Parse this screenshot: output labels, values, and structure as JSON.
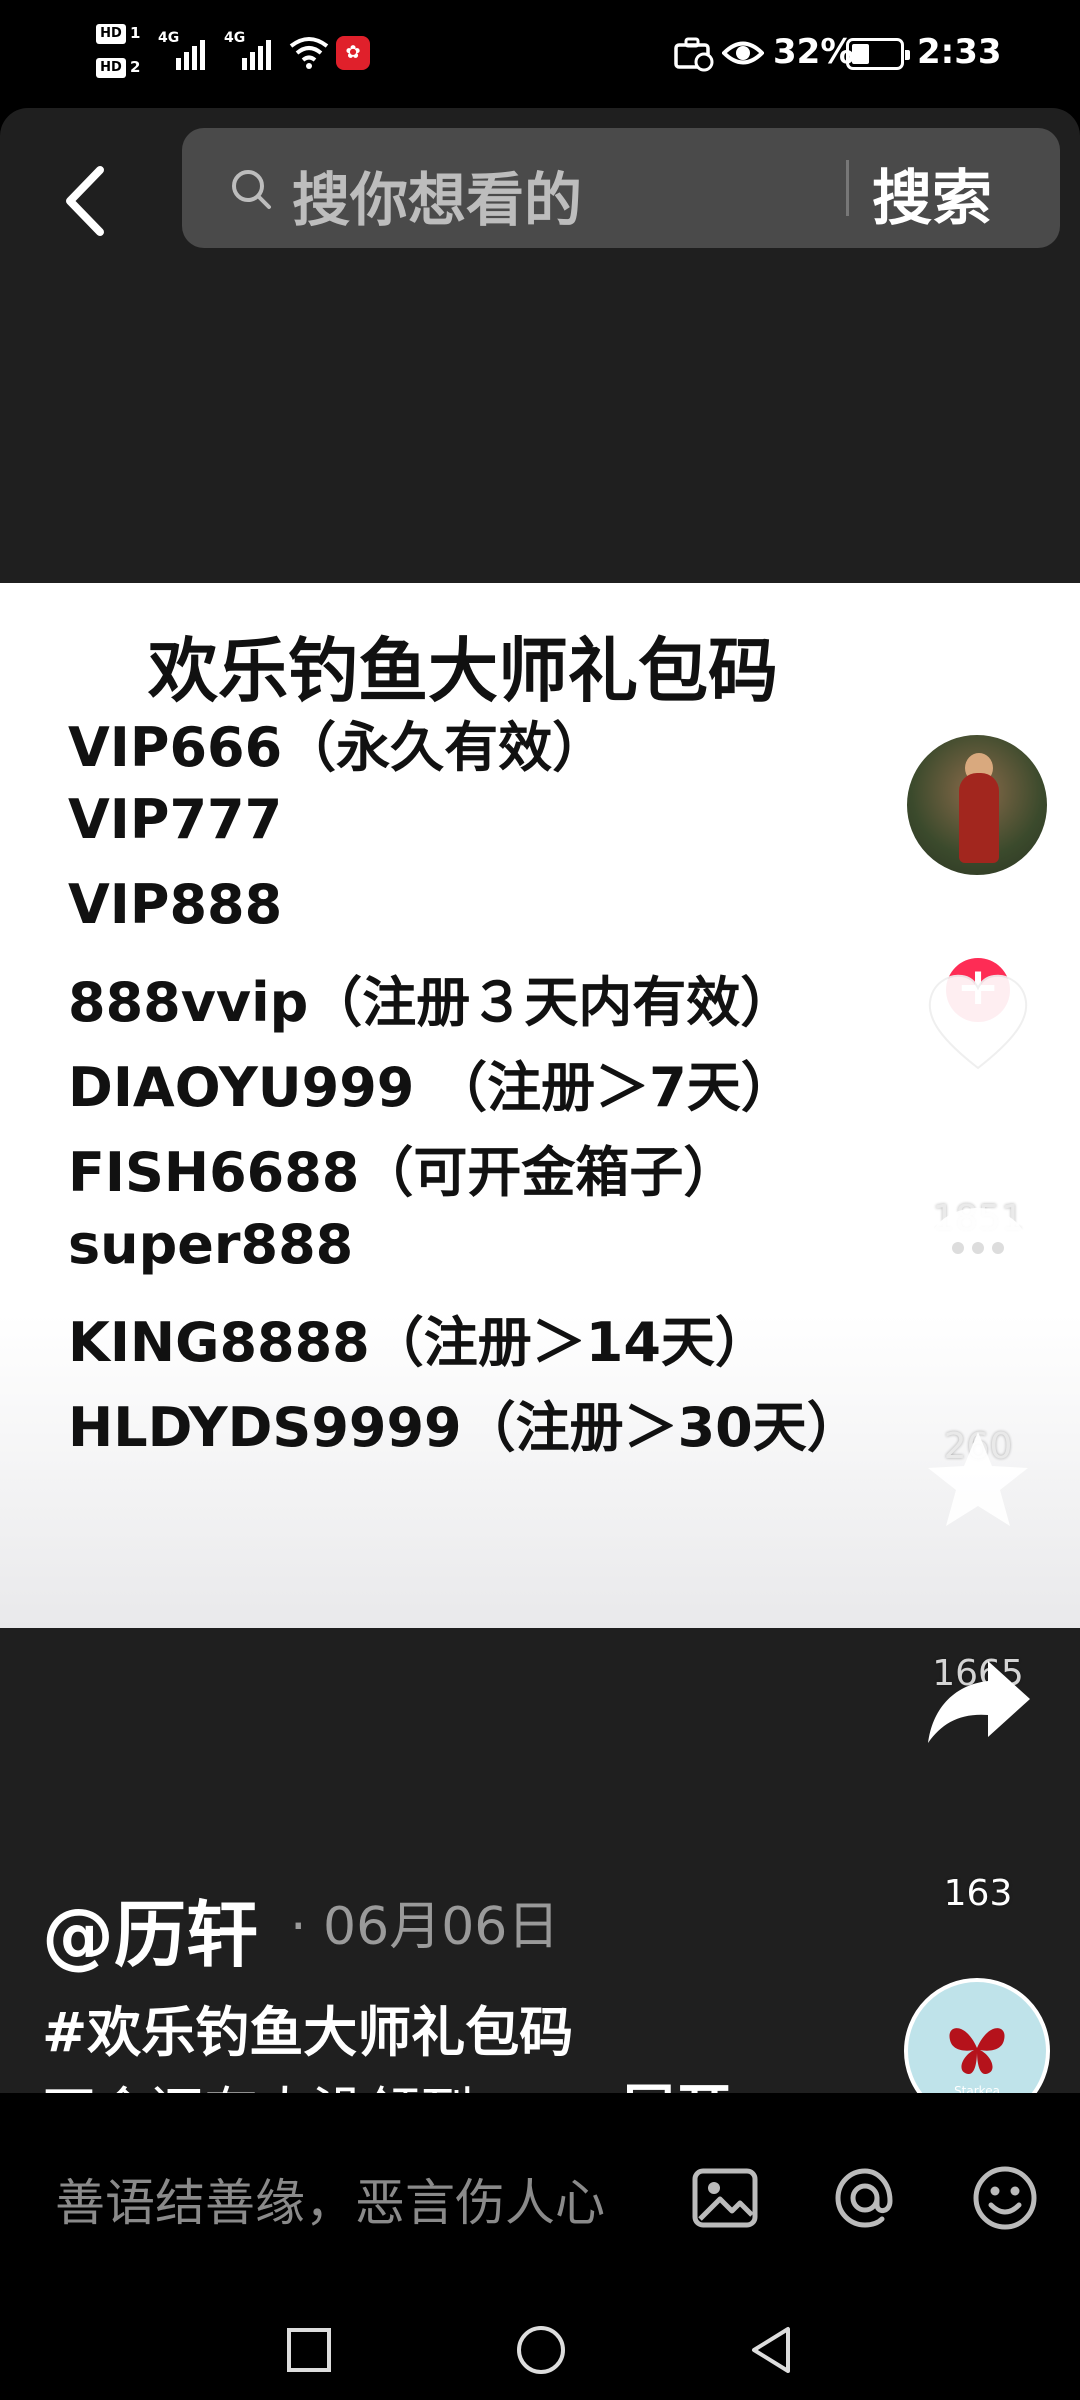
{
  "status_bar": {
    "hd1": "HD",
    "hd1_num": "1",
    "hd2": "HD",
    "hd2_num": "2",
    "network1": "4G",
    "network2": "4G",
    "battery_percent": "32%",
    "battery_level": 0.32,
    "time": "2:33"
  },
  "search": {
    "placeholder": "搜你想看的",
    "button_label": "搜索"
  },
  "video": {
    "title": "欢乐钓鱼大师礼包码",
    "codes": [
      "VIP666（永久有效）",
      "VIP777",
      "VIP888",
      "888vvip（注册３天内有效）",
      "DIAOYU999 （注册＞7天）",
      "FISH6688（可开金箱子）",
      "super888",
      "KING8888（注册＞14天）",
      "HLDYDS9999（注册＞30天）"
    ]
  },
  "rail": {
    "likes": "1851",
    "comments": "260",
    "favorites": "1665",
    "shares": "163"
  },
  "post": {
    "author": "@历轩",
    "date": "· 06月06日",
    "hashtag": "#欢乐钓鱼大师礼包码",
    "caption": "不会还有人没领到...",
    "expand_label": "展开",
    "music_label": "Starkea"
  },
  "progress": {
    "segments": 2,
    "active_segment": 1
  },
  "comment_bar": {
    "placeholder": "善语结善缘，恶言伤人心"
  },
  "colors": {
    "follow_accent": "#fe2c55",
    "panel_bg": "#1f1f1f",
    "search_bg": "#4a4a4a"
  }
}
